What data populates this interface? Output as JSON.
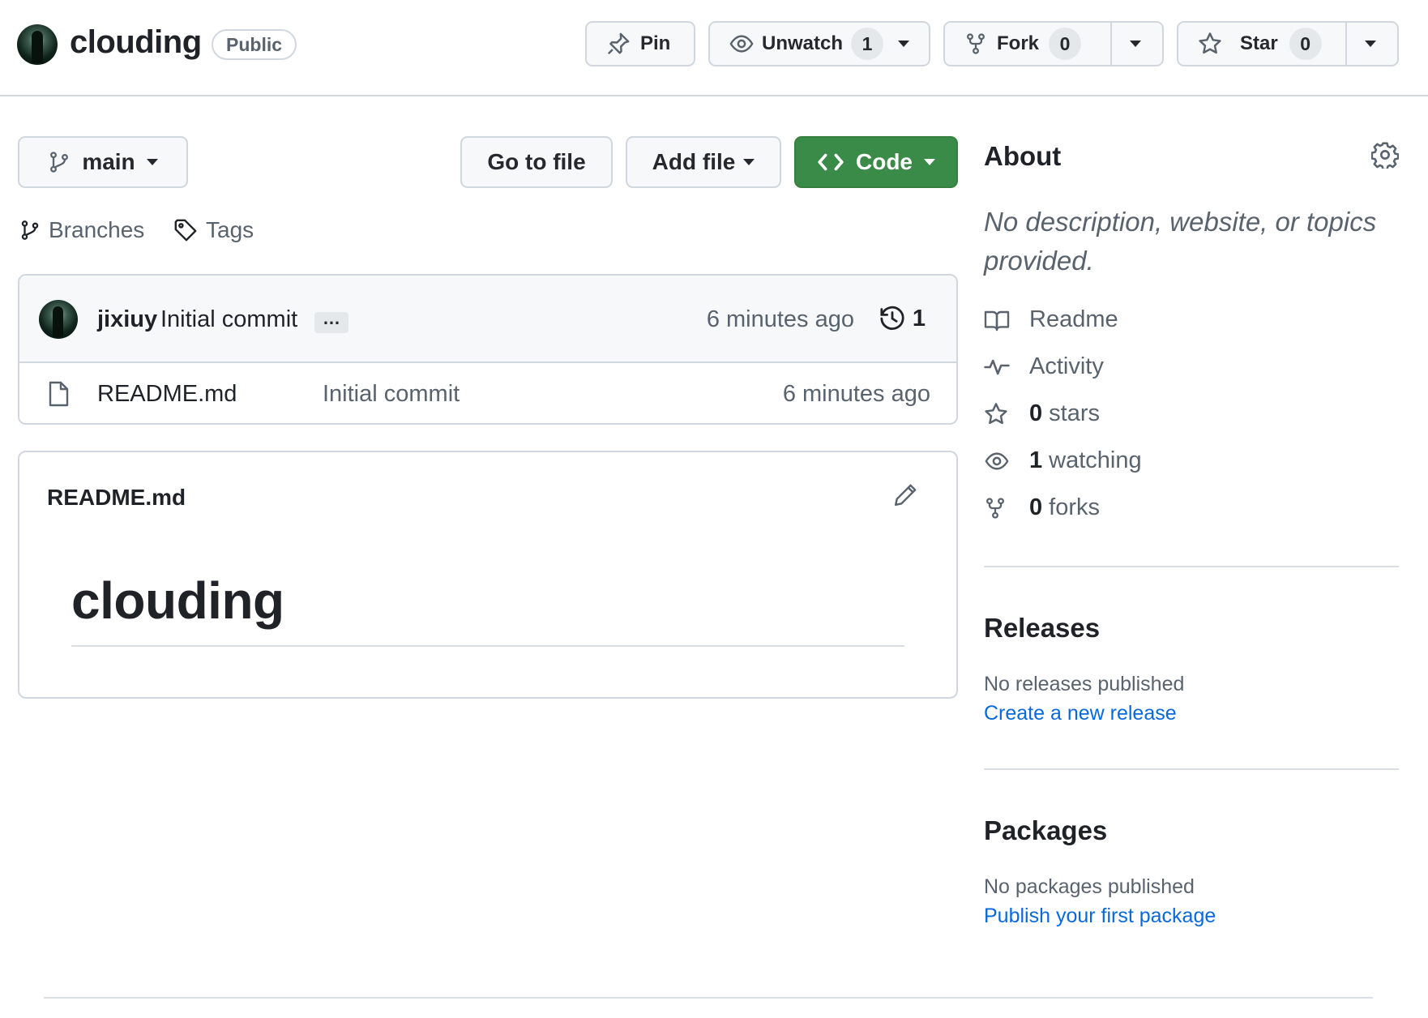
{
  "repo": {
    "name": "clouding",
    "visibility": "Public"
  },
  "header_actions": {
    "pin_label": "Pin",
    "unwatch_label": "Unwatch",
    "watch_count": "1",
    "fork_label": "Fork",
    "fork_count": "0",
    "star_label": "Star",
    "star_count": "0"
  },
  "toolbar": {
    "branch": "main",
    "go_to_file": "Go to file",
    "add_file": "Add file",
    "code": "Code",
    "branches_label": "Branches",
    "tags_label": "Tags"
  },
  "latest_commit": {
    "author": "jixiuy",
    "message": "Initial commit",
    "ellipsis": "…",
    "time": "6 minutes ago",
    "commit_count": "1"
  },
  "files": [
    {
      "name": "README.md",
      "message": "Initial commit",
      "time": "6 minutes ago",
      "icon": "file-icon"
    }
  ],
  "readme": {
    "title": "README.md",
    "heading": "clouding"
  },
  "about": {
    "heading": "About",
    "description": "No description, website, or topics provided.",
    "items": [
      {
        "icon": "book-icon",
        "label": "Readme"
      },
      {
        "icon": "pulse-icon",
        "label": "Activity"
      },
      {
        "icon": "star-icon",
        "count": "0",
        "label": "stars"
      },
      {
        "icon": "eye-icon",
        "count": "1",
        "label": "watching"
      },
      {
        "icon": "fork-icon",
        "count": "0",
        "label": "forks"
      }
    ]
  },
  "releases": {
    "heading": "Releases",
    "empty_text": "No releases published",
    "link": "Create a new release"
  },
  "packages": {
    "heading": "Packages",
    "empty_text": "No packages published",
    "link": "Publish your first package"
  },
  "colors": {
    "code_button": "#3a8a48",
    "link": "#0969da",
    "border": "#d0d7de",
    "muted_text": "#59636e"
  }
}
